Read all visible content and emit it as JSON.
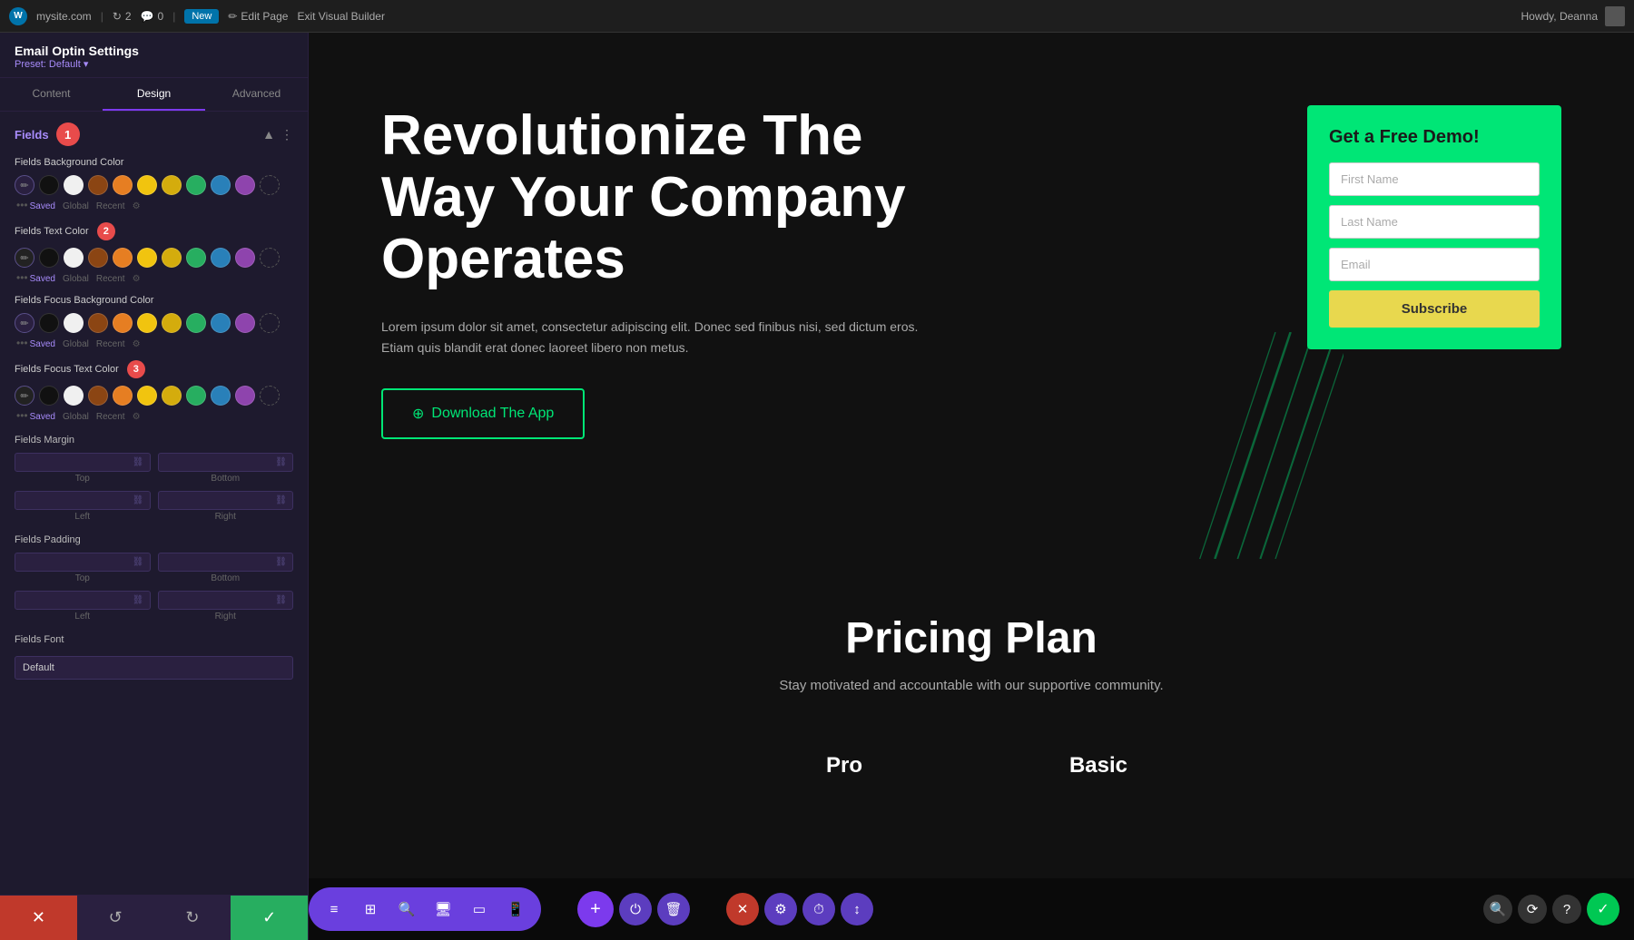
{
  "topbar": {
    "wp_icon": "W",
    "site_name": "mysite.com",
    "updates_count": "2",
    "comments_count": "0",
    "new_label": "New",
    "edit_page_label": "Edit Page",
    "exit_builder_label": "Exit Visual Builder",
    "howdy_label": "Howdy, Deanna"
  },
  "panel": {
    "title": "Email Optin Settings",
    "preset_label": "Preset: Default ▾",
    "tabs": [
      "Content",
      "Design",
      "Advanced"
    ],
    "active_tab": "Design",
    "fields_section": {
      "title": "Fields",
      "badge": "1",
      "sections": [
        {
          "label": "Fields Background Color",
          "badge": null,
          "swatches": [
            "pen",
            "black",
            "white",
            "brown",
            "orange",
            "yellow",
            "yellow2",
            "green",
            "blue",
            "purple",
            "eraser"
          ],
          "meta": [
            "Saved",
            "Global",
            "Recent"
          ]
        },
        {
          "label": "Fields Text Color",
          "badge": "2",
          "swatches": [
            "pen",
            "black",
            "white",
            "brown",
            "orange",
            "yellow",
            "yellow2",
            "green",
            "blue",
            "purple",
            "eraser"
          ],
          "meta": [
            "Saved",
            "Global",
            "Recent"
          ]
        },
        {
          "label": "Fields Focus Background Color",
          "badge": null,
          "swatches": [
            "pen",
            "black",
            "white",
            "brown",
            "orange",
            "yellow",
            "yellow2",
            "green",
            "blue",
            "purple",
            "eraser"
          ],
          "meta": [
            "Saved",
            "Global",
            "Recent"
          ]
        },
        {
          "label": "Fields Focus Text Color",
          "badge": "3",
          "swatches": [
            "pen",
            "black",
            "white",
            "brown",
            "orange",
            "yellow",
            "yellow2",
            "green",
            "blue",
            "purple",
            "eraser"
          ],
          "meta": [
            "Saved",
            "Global",
            "Recent"
          ]
        }
      ],
      "margin_label": "Fields Margin",
      "margin_fields": [
        "Top",
        "Bottom",
        "Left",
        "Right"
      ],
      "padding_label": "Fields Padding",
      "padding_fields": [
        "Top",
        "Bottom",
        "Left",
        "Right"
      ],
      "font_label": "Fields Font",
      "font_value": "Default"
    }
  },
  "preview": {
    "hero": {
      "title": "Revolutionize The Way Your Company Operates",
      "description": "Lorem ipsum dolor sit amet, consectetur adipiscing elit. Donec sed finibus nisi, sed dictum eros. Etiam quis blandit erat donec laoreet libero non metus.",
      "cta_label": "Download The App"
    },
    "form": {
      "title": "Get a Free Demo!",
      "first_name_placeholder": "First Name",
      "last_name_placeholder": "Last Name",
      "email_placeholder": "Email",
      "subscribe_label": "Subscribe"
    },
    "pricing": {
      "title": "Pricing Plan",
      "subtitle": "Stay motivated and accountable with our supportive community.",
      "cards": [
        "Pro",
        "Basic"
      ]
    }
  },
  "footer": {
    "cancel_icon": "✕",
    "undo_icon": "↺",
    "redo_icon": "↻",
    "save_icon": "✓"
  },
  "bottom_toolbar": {
    "tools": [
      "≡",
      "⊞",
      "🔍",
      "□",
      "⬜",
      "▯"
    ],
    "actions": [
      "+",
      "⏻",
      "🗑",
      "✕",
      "⚙",
      "⏱",
      "↕"
    ],
    "right_actions": [
      "🔍",
      "⟳",
      "?"
    ]
  }
}
